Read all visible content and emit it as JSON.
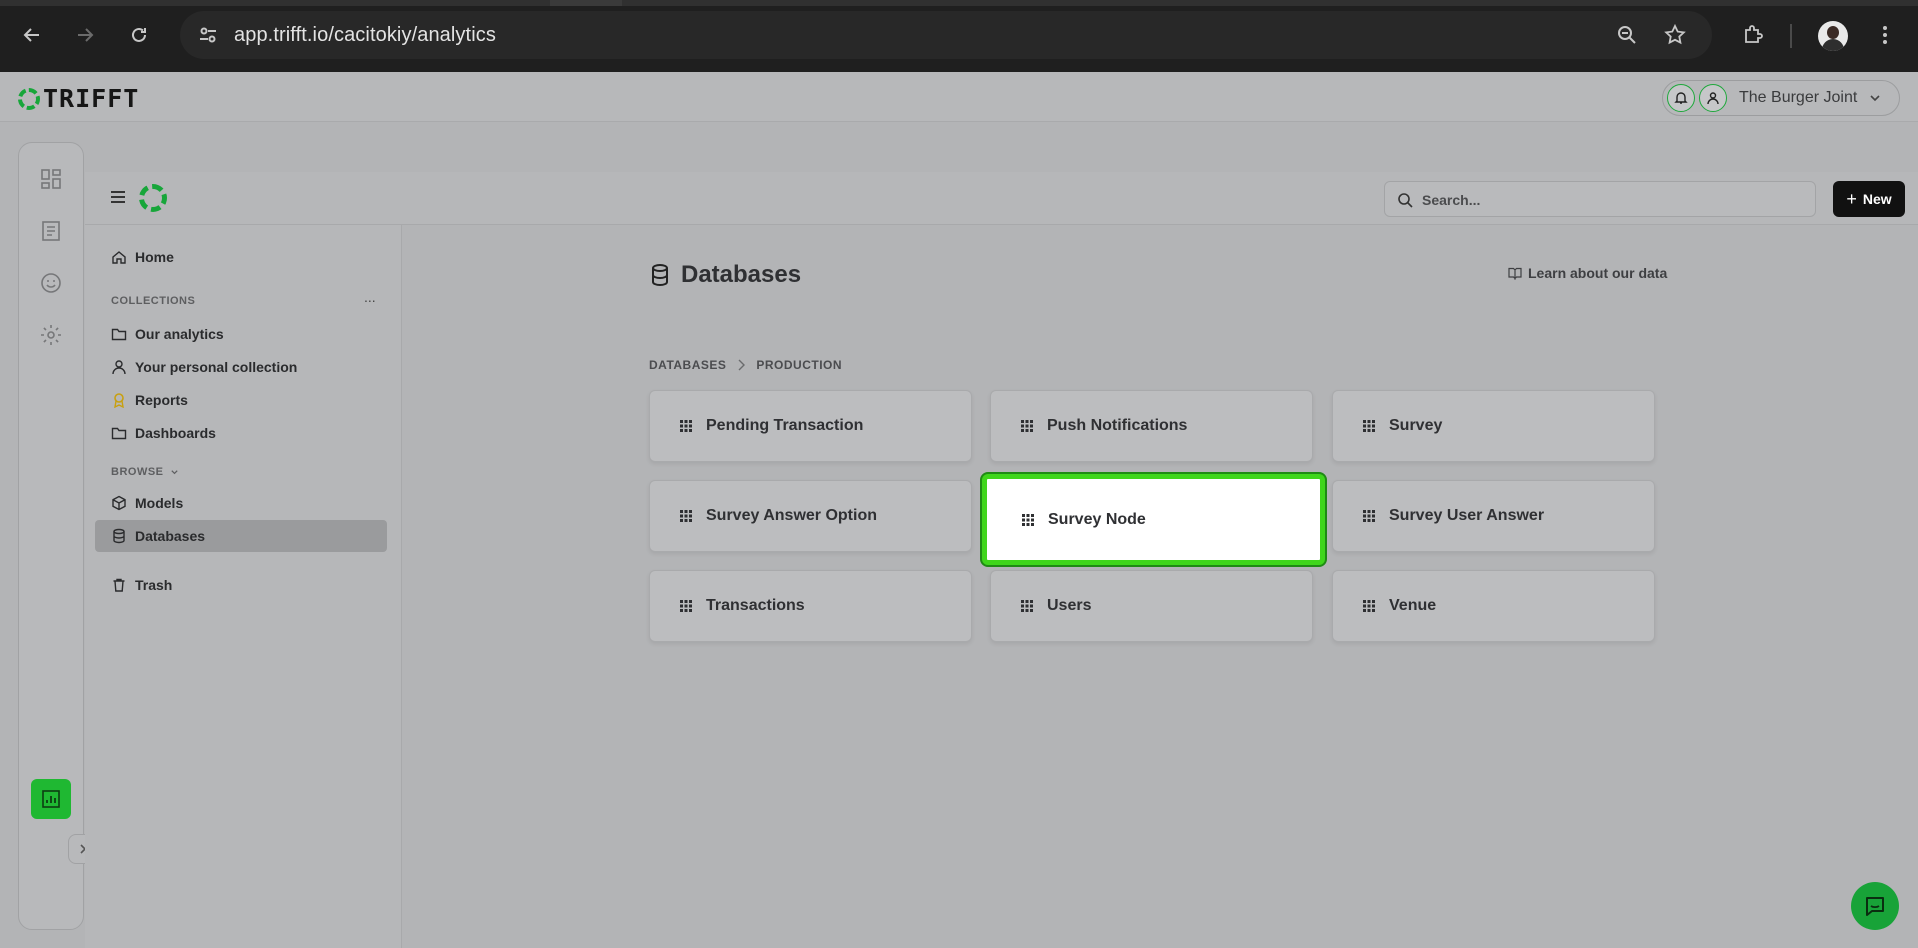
{
  "browser": {
    "url": "app.trifft.io/cacitokiy/analytics"
  },
  "app": {
    "logo_text": "TRIFFT",
    "org_name": "The Burger Joint",
    "accent_color": "#1fb832"
  },
  "topbar": {
    "search_placeholder": "Search...",
    "new_label": "New"
  },
  "sidebar": {
    "home_label": "Home",
    "collections_heading": "COLLECTIONS",
    "more_label": "...",
    "collections": [
      {
        "label": "Our analytics",
        "icon": "folder-icon"
      },
      {
        "label": "Your personal collection",
        "icon": "person-icon"
      },
      {
        "label": "Reports",
        "icon": "badge-icon"
      },
      {
        "label": "Dashboards",
        "icon": "folder-icon"
      }
    ],
    "browse_heading": "BROWSE",
    "browse": [
      {
        "label": "Models",
        "icon": "cube-icon"
      },
      {
        "label": "Databases",
        "icon": "database-icon",
        "active": true
      }
    ],
    "trash_label": "Trash"
  },
  "main": {
    "title": "Databases",
    "learn_link": "Learn about our data",
    "breadcrumb": [
      "DATABASES",
      "PRODUCTION"
    ],
    "tables": [
      "Pending Transaction",
      "Push Notifications",
      "Survey",
      "Survey Answer Option",
      "Survey Node",
      "Survey User Answer",
      "Transactions",
      "Users",
      "Venue"
    ],
    "highlighted_table": "Survey Node"
  }
}
